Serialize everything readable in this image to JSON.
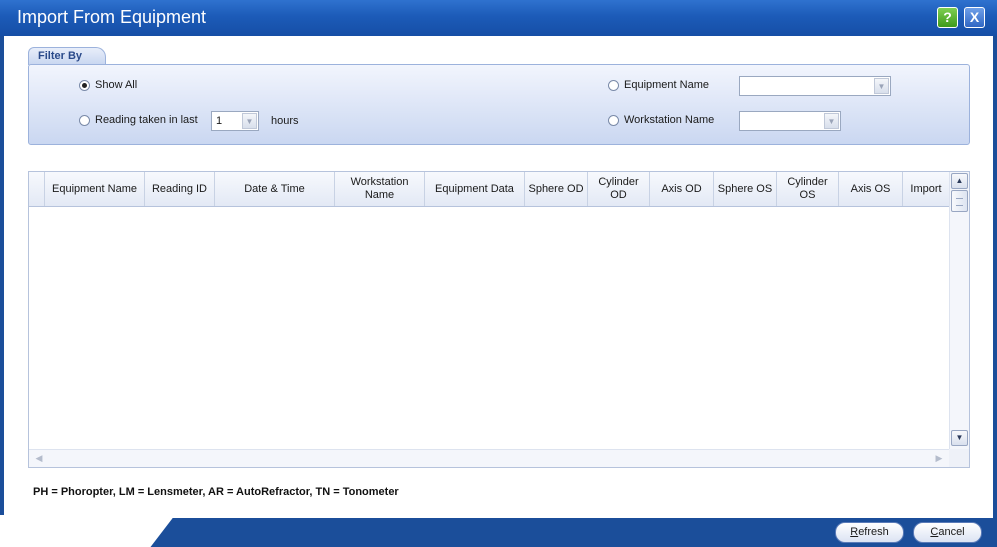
{
  "window": {
    "title": "Import From Equipment",
    "help_symbol": "?",
    "close_symbol": "X"
  },
  "filter": {
    "group_label": "Filter By",
    "show_all_label": "Show All",
    "show_all_checked": true,
    "reading_label": "Reading taken in last",
    "reading_checked": false,
    "hours_value": "1",
    "hours_label": "hours",
    "equipment_name_label": "Equipment Name",
    "equipment_name_checked": false,
    "equipment_name_value": "",
    "workstation_name_label": "Workstation Name",
    "workstation_name_checked": false,
    "workstation_name_value": ""
  },
  "grid": {
    "columns": [
      "Equipment Name",
      "Reading ID",
      "Date & Time",
      "Workstation Name",
      "Equipment Data",
      "Sphere OD",
      "Cylinder OD",
      "Axis OD",
      "Sphere OS",
      "Cylinder OS",
      "Axis OS",
      "Import"
    ],
    "rows": []
  },
  "legend": "PH = Phoropter, LM = Lensmeter, AR = AutoRefractor, TN = Tonometer",
  "buttons": {
    "refresh_first": "R",
    "refresh_rest": "efresh",
    "cancel_first": "C",
    "cancel_rest": "ancel"
  },
  "colors": {
    "titlebar": "#1c5bb8",
    "frame": "#1b4e9a",
    "filter_panel": "#cad7f1"
  }
}
